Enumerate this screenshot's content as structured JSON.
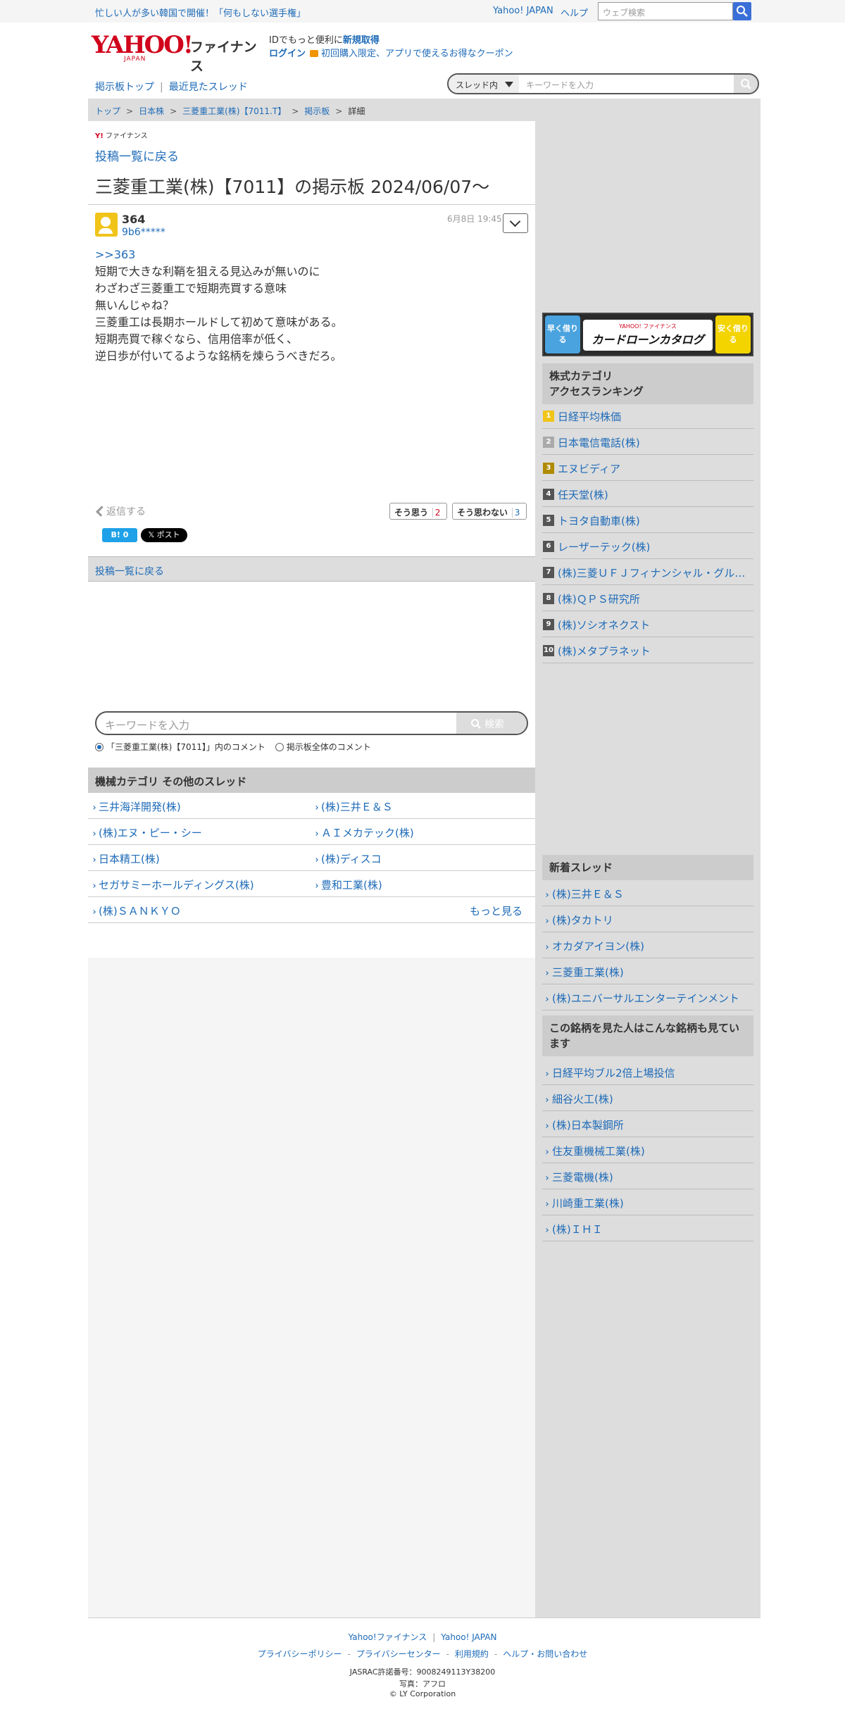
{
  "topbar": {
    "promo": "忙しい人が多い韓国で開催！「何もしない選手権」",
    "yahoo_japan": "Yahoo! JAPAN",
    "help": "ヘルプ",
    "web_search_placeholder": "ウェブ検索"
  },
  "header": {
    "logo_main": "YAHOO!",
    "logo_sub": "JAPAN",
    "logo_finance": "ファイナンス",
    "id_text": "IDでもっと便利に",
    "id_register": "新規取得",
    "login": "ログイン",
    "coupon": "初回購入限定、アプリで使えるお得なクーポン"
  },
  "subnav": {
    "board_top": "掲示板トップ",
    "recent": "最近見たスレッド"
  },
  "board_search": {
    "scope": "スレッド内",
    "placeholder": "キーワードを入力"
  },
  "breadcrumb": {
    "items": [
      "トップ",
      "日本株",
      "三菱重工業(株)【7011.T】",
      "掲示板"
    ],
    "current": "詳細"
  },
  "main": {
    "small_logo_y": "Y!",
    "small_logo_text": "ファイナンス",
    "back_link": "投稿一覧に戻る",
    "page_title": "三菱重工業(株)【7011】の掲示板 2024/06/07〜"
  },
  "post": {
    "number": "364",
    "user": "9b6*****",
    "date": "6月8日 19:45",
    "anchor": ">>363",
    "lines": [
      "短期で大きな利鞘を狙える見込みが無いのに",
      "わざわざ三菱重工で短期売買する意味",
      "無いんじゃね？",
      "三菱重工は長期ホールドして初めて意味がある。",
      "短期売買で稼ぐなら、信用倍率が低く、",
      "逆日歩が付いてるような銘柄を煉らうべきだろ。"
    ],
    "reply": "返信する",
    "agree_label": "そう思う",
    "agree_count": "2",
    "disagree_label": "そう思わない",
    "disagree_count": "3",
    "hatena": "B! 0",
    "xpost": "𝕏 ポスト"
  },
  "back_bar": "投稿一覧に戻る",
  "main_search": {
    "placeholder": "キーワードを入力",
    "button": "検索",
    "radio1": "「三菱重工業(株)【7011】」内のコメント",
    "radio2": "掲示板全体のコメント"
  },
  "threads": {
    "heading": "機械カテゴリ その他のスレッド",
    "rows": [
      [
        "三井海洋開発(株)",
        "(株)三井Ｅ＆Ｓ"
      ],
      [
        "(株)エヌ・ピー・シー",
        "ＡＩメカテック(株)"
      ],
      [
        "日本精工(株)",
        "(株)ディスコ"
      ],
      [
        "セガサミーホールディングス(株)",
        "豊和工業(株)"
      ]
    ],
    "last": "(株)ＳＡＮＫＹＯ",
    "more": "もっと見る"
  },
  "sidebar": {
    "banner": {
      "left": "早く借りる",
      "brand": "YAHOO! ファイナンス",
      "title": "カードローンカタログ",
      "right": "安く借りる"
    },
    "ranking_heading_1": "株式カテゴリ",
    "ranking_heading_2": "アクセスランキング",
    "ranking": [
      {
        "rank": "1",
        "name": "日経平均株価",
        "color": "#f0c419"
      },
      {
        "rank": "2",
        "name": "日本電信電話(株)",
        "color": "#aaaaaa"
      },
      {
        "rank": "3",
        "name": "エヌビディア",
        "color": "#b08a00"
      },
      {
        "rank": "4",
        "name": "任天堂(株)",
        "color": "#555555"
      },
      {
        "rank": "5",
        "name": "トヨタ自動車(株)",
        "color": "#555555"
      },
      {
        "rank": "6",
        "name": "レーザーテック(株)",
        "color": "#555555"
      },
      {
        "rank": "7",
        "name": "(株)三菱ＵＦＪフィナンシャル・グループ",
        "color": "#555555"
      },
      {
        "rank": "8",
        "name": "(株)ＱＰＳ研究所",
        "color": "#555555"
      },
      {
        "rank": "9",
        "name": "(株)ソシオネクスト",
        "color": "#555555"
      },
      {
        "rank": "10",
        "name": "(株)メタプラネット",
        "color": "#555555"
      }
    ],
    "new_threads_heading": "新着スレッド",
    "new_threads": [
      "(株)三井Ｅ＆Ｓ",
      "(株)タカトリ",
      "オカダアイヨン(株)",
      "三菱重工業(株)",
      "(株)ユニバーサルエンターテインメント"
    ],
    "related_heading": "この銘柄を見た人はこんな銘柄も見ています",
    "related": [
      "日経平均ブル2倍上場投信",
      "細谷火工(株)",
      "(株)日本製鋼所",
      "住友重機械工業(株)",
      "三菱電機(株)",
      "川崎重工業(株)",
      "(株)ＩＨＩ"
    ]
  },
  "footer": {
    "finance": "Yahoo!ファイナンス",
    "yahoo_japan": "Yahoo! JAPAN",
    "privacy_policy": "プライバシーポリシー",
    "privacy_center": "プライバシーセンター",
    "terms": "利用規約",
    "help_contact": "ヘルプ・お問い合わせ",
    "jasrac": "JASRAC許諾番号：9008249113Y38200",
    "photo": "写真：アフロ",
    "copyright": "© LY Corporation"
  }
}
